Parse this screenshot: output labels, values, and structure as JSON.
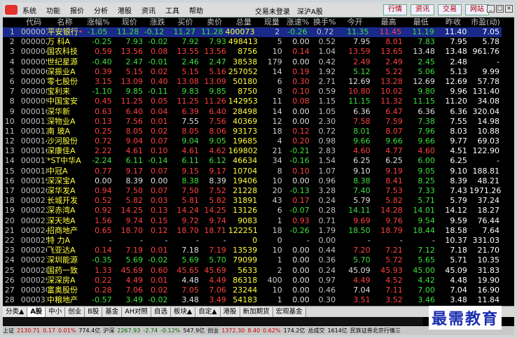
{
  "menu": {
    "items": [
      "系统",
      "功能",
      "报价",
      "分析",
      "港股",
      "资讯",
      "工具",
      "帮助"
    ],
    "center": [
      "交易未登录",
      "深沪A股"
    ],
    "right_buttons": [
      "行情",
      "资讯",
      "交易",
      "网站"
    ],
    "window_buttons": [
      "_",
      "□",
      "×"
    ]
  },
  "table": {
    "columns": [
      "",
      "代码",
      "名称",
      "涨幅%",
      "现价",
      "涨跌",
      "买价",
      "卖价",
      "总量",
      "现量",
      "涨速%",
      "换手%",
      "今开",
      "最高",
      "最低",
      "昨收",
      "市盈(动)"
    ],
    "rows": [
      {
        "idx": "1",
        "code": "000001",
        "name": "平安银行",
        "mark": "•",
        "chgp": "-1.05",
        "price": "11.28",
        "chg": "-0.12",
        "bid": "11.27",
        "ask": "11.28",
        "vol": "400073",
        "cur": "2",
        "speed": "-0.26",
        "turn": "0.72",
        "open": "11.35",
        "high": "11.45",
        "low": "11.19",
        "prev": "11.40",
        "pe": "7.05",
        "sel": true
      },
      {
        "idx": "2",
        "code": "000002",
        "name": "万 科A",
        "chgp": "-0.25",
        "price": "7.93",
        "chg": "-0.02",
        "bid": "7.92",
        "ask": "7.93",
        "vol": "498413",
        "cur": "5",
        "speed": "0.00",
        "turn": "0.52",
        "open": "7.95",
        "high": "8.01",
        "low": "7.83",
        "prev": "7.95",
        "pe": "5.78"
      },
      {
        "idx": "3",
        "code": "000004",
        "name": "国农科技",
        "chgp": "0.59",
        "price": "13.56",
        "chg": "0.08",
        "bid": "13.55",
        "ask": "13.56",
        "vol": "8756",
        "cur": "10",
        "speed": "0.14",
        "turn": "1.04",
        "open": "13.59",
        "high": "13.65",
        "low": "13.48",
        "prev": "13.48",
        "pe": "961.76"
      },
      {
        "idx": "4",
        "code": "000005",
        "name": "世纪星源",
        "chgp": "-0.40",
        "price": "2.47",
        "chg": "-0.01",
        "bid": "2.46",
        "ask": "2.47",
        "vol": "38538",
        "cur": "179",
        "speed": "0.00",
        "turn": "0.42",
        "open": "2.49",
        "high": "2.49",
        "low": "2.45",
        "prev": "2.48",
        "pe": "-"
      },
      {
        "idx": "5",
        "code": "000006",
        "name": "深振业A",
        "chgp": "0.39",
        "price": "5.15",
        "chg": "0.02",
        "bid": "5.15",
        "ask": "5.16",
        "vol": "257052",
        "cur": "14",
        "speed": "0.19",
        "turn": "1.92",
        "open": "5.12",
        "high": "5.22",
        "low": "5.06",
        "prev": "5.13",
        "pe": "9.99"
      },
      {
        "idx": "6",
        "code": "000007",
        "name": "零七股份",
        "chgp": "3.15",
        "price": "13.09",
        "chg": "0.40",
        "bid": "13.08",
        "ask": "13.09",
        "vol": "50180",
        "cur": "6",
        "speed": "0.30",
        "turn": "2.71",
        "open": "12.69",
        "high": "13.28",
        "low": "12.69",
        "prev": "12.69",
        "pe": "57.78"
      },
      {
        "idx": "7",
        "code": "000008",
        "name": "宝利来",
        "chgp": "-1.10",
        "price": "9.85",
        "chg": "-0.11",
        "bid": "9.83",
        "ask": "9.85",
        "vol": "8750",
        "cur": "8",
        "speed": "0.10",
        "turn": "0.59",
        "open": "10.80",
        "high": "10.02",
        "low": "9.80",
        "prev": "9.96",
        "pe": "131.40"
      },
      {
        "idx": "8",
        "code": "000009",
        "name": "中国宝安",
        "chgp": "0.45",
        "price": "11.25",
        "chg": "0.05",
        "bid": "11.25",
        "ask": "11.26",
        "vol": "142953",
        "cur": "11",
        "speed": "0.08",
        "turn": "1.15",
        "open": "11.15",
        "high": "11.32",
        "low": "11.15",
        "prev": "11.20",
        "pe": "34.08"
      },
      {
        "idx": "9",
        "code": "000010",
        "name": "深华新",
        "chgp": "0.63",
        "price": "6.40",
        "chg": "0.04",
        "bid": "6.39",
        "ask": "6.40",
        "vol": "28498",
        "cur": "14",
        "speed": "0.00",
        "turn": "1.05",
        "open": "6.36",
        "high": "6.47",
        "low": "6.36",
        "prev": "6.36",
        "pe": "320.04"
      },
      {
        "idx": "10",
        "code": "000011",
        "name": "深物业A",
        "chgp": "0.13",
        "price": "7.56",
        "chg": "0.01",
        "bid": "7.55",
        "ask": "7.56",
        "vol": "40369",
        "cur": "12",
        "speed": "0.00",
        "turn": "2.30",
        "open": "7.58",
        "high": "7.59",
        "low": "7.38",
        "prev": "7.55",
        "pe": "14.98"
      },
      {
        "idx": "11",
        "code": "000012",
        "name": "南 玻A",
        "chgp": "0.25",
        "price": "8.05",
        "chg": "0.02",
        "bid": "8.05",
        "ask": "8.06",
        "vol": "93173",
        "cur": "18",
        "speed": "0.12",
        "turn": "0.72",
        "open": "8.01",
        "high": "8.07",
        "low": "7.96",
        "prev": "8.03",
        "pe": "10.88"
      },
      {
        "idx": "12",
        "code": "000014",
        "name": "沙河股份",
        "chgp": "0.72",
        "price": "9.04",
        "chg": "0.07",
        "bid": "9.04",
        "ask": "9.05",
        "vol": "19685",
        "cur": "4",
        "speed": "0.20",
        "turn": "0.98",
        "open": "9.66",
        "high": "9.66",
        "low": "9.66",
        "prev": "9.77",
        "pe": "69.03"
      },
      {
        "idx": "13",
        "code": "000016",
        "name": "深康佳A",
        "chgp": "2.22",
        "price": "4.61",
        "chg": "0.10",
        "bid": "4.61",
        "ask": "4.62",
        "vol": "169802",
        "cur": "21",
        "speed": "-0.21",
        "turn": "2.83",
        "open": "4.60",
        "high": "4.77",
        "low": "4.60",
        "prev": "4.51",
        "pe": "122.90"
      },
      {
        "idx": "14",
        "code": "000017",
        "name": "*ST中华A",
        "chgp": "-2.24",
        "price": "6.11",
        "chg": "-0.14",
        "bid": "6.11",
        "ask": "6.12",
        "vol": "46634",
        "cur": "34",
        "speed": "-0.16",
        "turn": "1.54",
        "open": "6.25",
        "high": "6.25",
        "low": "6.00",
        "prev": "6.25",
        "pe": "-"
      },
      {
        "idx": "15",
        "code": "000018",
        "name": "中冠A",
        "chgp": "0.77",
        "price": "9.17",
        "chg": "0.07",
        "bid": "9.15",
        "ask": "9.17",
        "vol": "10704",
        "cur": "8",
        "speed": "0.10",
        "turn": "1.07",
        "open": "9.10",
        "high": "9.19",
        "low": "9.05",
        "prev": "9.10",
        "pe": "188.81"
      },
      {
        "idx": "16",
        "code": "000019",
        "name": "深深宝A",
        "chgp": "0.00",
        "price": "8.39",
        "chg": "0.00",
        "bid": "8.38",
        "ask": "8.39",
        "vol": "19406",
        "cur": "10",
        "speed": "0.00",
        "turn": "0.96",
        "open": "8.38",
        "high": "8.41",
        "low": "8.25",
        "prev": "8.39",
        "pe": "48.21"
      },
      {
        "idx": "17",
        "code": "000020",
        "name": "深华发A",
        "chgp": "0.94",
        "price": "7.50",
        "chg": "0.07",
        "bid": "7.50",
        "ask": "7.52",
        "vol": "21228",
        "cur": "20",
        "speed": "-0.13",
        "turn": "3.28",
        "open": "7.40",
        "high": "7.53",
        "low": "7.33",
        "prev": "7.43",
        "pe": "1971.26"
      },
      {
        "idx": "18",
        "code": "000021",
        "name": "长城开发",
        "chgp": "0.52",
        "price": "5.82",
        "chg": "0.03",
        "bid": "5.81",
        "ask": "5.82",
        "vol": "31891",
        "cur": "43",
        "speed": "0.17",
        "turn": "0.24",
        "open": "5.79",
        "high": "5.82",
        "low": "5.71",
        "prev": "5.79",
        "pe": "37.24"
      },
      {
        "idx": "19",
        "code": "000022",
        "name": "深赤湾A",
        "chgp": "0.92",
        "price": "14.25",
        "chg": "0.13",
        "bid": "14.24",
        "ask": "14.25",
        "vol": "13126",
        "cur": "6",
        "speed": "-0.07",
        "turn": "0.28",
        "open": "14.11",
        "high": "14.28",
        "low": "14.01",
        "prev": "14.12",
        "pe": "18.27"
      },
      {
        "idx": "20",
        "code": "000023",
        "name": "深天地A",
        "chgp": "1.56",
        "price": "9.74",
        "chg": "0.15",
        "bid": "9.72",
        "ask": "9.74",
        "vol": "9083",
        "cur": "1",
        "speed": "0.93",
        "turn": "0.71",
        "open": "9.69",
        "high": "9.76",
        "low": "9.54",
        "prev": "9.59",
        "pe": "76.44"
      },
      {
        "idx": "21",
        "code": "000024",
        "name": "招商地产",
        "chgp": "0.65",
        "price": "18.70",
        "chg": "0.12",
        "bid": "18.70",
        "ask": "18.71",
        "vol": "122251",
        "cur": "18",
        "speed": "-0.26",
        "turn": "1.79",
        "open": "18.50",
        "high": "18.79",
        "low": "18.44",
        "prev": "18.58",
        "pe": "7.64"
      },
      {
        "idx": "22",
        "code": "000025",
        "name": "特 力A",
        "chgp": "-",
        "price": "-",
        "chg": "-",
        "bid": "-",
        "ask": "-",
        "vol": "0",
        "cur": "0",
        "speed": "-",
        "turn": "0.00",
        "open": "-",
        "high": "-",
        "low": "-",
        "prev": "10.37",
        "pe": "331.03"
      },
      {
        "idx": "23",
        "code": "000026",
        "name": "飞亚达A",
        "chgp": "0.14",
        "price": "7.19",
        "chg": "0.01",
        "bid": "7.18",
        "ask": "7.19",
        "vol": "13539",
        "cur": "10",
        "speed": "0.00",
        "turn": "0.44",
        "open": "7.20",
        "high": "7.21",
        "low": "7.12",
        "prev": "7.18",
        "pe": "21.70"
      },
      {
        "idx": "24",
        "code": "000027",
        "name": "深圳能源",
        "chgp": "-0.35",
        "price": "5.69",
        "chg": "-0.02",
        "bid": "5.69",
        "ask": "5.70",
        "vol": "79099",
        "cur": "1",
        "speed": "0.00",
        "turn": "0.36",
        "open": "5.70",
        "high": "5.72",
        "low": "5.65",
        "prev": "5.71",
        "pe": "10.35"
      },
      {
        "idx": "25",
        "code": "000028",
        "name": "国药一致",
        "chgp": "1.33",
        "price": "45.69",
        "chg": "0.60",
        "bid": "45.65",
        "ask": "45.69",
        "vol": "5633",
        "cur": "2",
        "speed": "0.00",
        "turn": "0.24",
        "open": "45.09",
        "high": "45.93",
        "low": "45.00",
        "prev": "45.09",
        "pe": "31.83"
      },
      {
        "idx": "26",
        "code": "000029",
        "name": "深深房A",
        "chgp": "0.22",
        "price": "4.49",
        "chg": "0.01",
        "bid": "4.48",
        "ask": "4.49",
        "vol": "86318",
        "cur": "400",
        "speed": "0.00",
        "turn": "0.97",
        "open": "4.49",
        "high": "4.52",
        "low": "4.42",
        "prev": "4.48",
        "pe": "19.90"
      },
      {
        "idx": "27",
        "code": "000030",
        "name": "富奥股份",
        "chgp": "0.28",
        "price": "7.06",
        "chg": "0.02",
        "bid": "7.05",
        "ask": "7.06",
        "vol": "23244",
        "cur": "10",
        "speed": "0.00",
        "turn": "0.46",
        "open": "7.04",
        "high": "7.11",
        "low": "7.00",
        "prev": "7.04",
        "pe": "16.90"
      },
      {
        "idx": "28",
        "code": "000031",
        "name": "中粮地产",
        "chgp": "-0.57",
        "price": "3.49",
        "chg": "-0.02",
        "bid": "3.48",
        "ask": "3.49",
        "vol": "54183",
        "cur": "1",
        "speed": "0.00",
        "turn": "0.30",
        "open": "3.51",
        "high": "3.52",
        "low": "3.46",
        "prev": "3.48",
        "pe": "11.84"
      }
    ]
  },
  "tabs": [
    "分类▲",
    "A股",
    "中小",
    "创业",
    "B股",
    "基金",
    "AH对照",
    "自选",
    "板块▲",
    "自定▲",
    "港股",
    "新加期货",
    "宏观基金"
  ],
  "status": {
    "sh_label": "上证",
    "sh_value": "2130.71",
    "sh_chg": "0.17",
    "sh_pct": "0.01%",
    "sh_amt": "774.4亿",
    "sz_label": "沪深",
    "sz_value": "2267.93",
    "sz_chg": "-2.74",
    "sz_pct": "-0.12%",
    "sz_amt": "547.9亿",
    "cy_label": "创业",
    "cy_value": "1372.30",
    "cy_chg": "8.40",
    "cy_pct": "0.62%",
    "cy_amt": "174.2亿",
    "total_label": "总成交",
    "total": "1614亿",
    "broker": "民族证券北京行情三"
  },
  "watermark": "最需教育"
}
